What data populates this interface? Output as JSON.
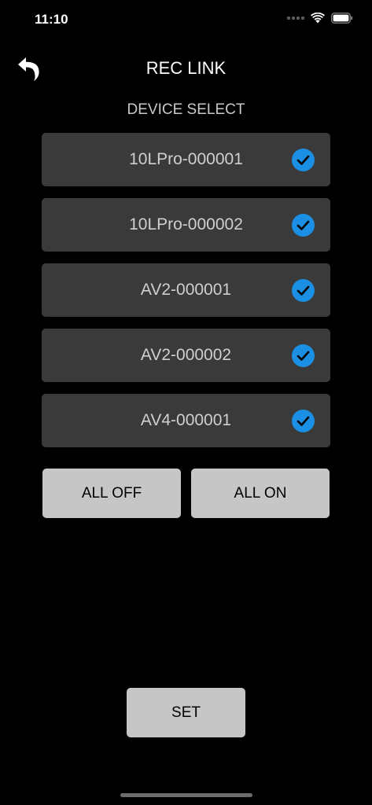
{
  "status_bar": {
    "time": "11:10"
  },
  "header": {
    "title": "REC LINK"
  },
  "section": {
    "title": "DEVICE SELECT"
  },
  "devices": [
    {
      "name": "10LPro-000001",
      "selected": true
    },
    {
      "name": "10LPro-000002",
      "selected": true
    },
    {
      "name": "AV2-000001",
      "selected": true
    },
    {
      "name": "AV2-000002",
      "selected": true
    },
    {
      "name": "AV4-000001",
      "selected": true
    }
  ],
  "buttons": {
    "all_off": "ALL OFF",
    "all_on": "ALL ON",
    "set": "SET"
  },
  "colors": {
    "background": "#000000",
    "row": "#3a3a3a",
    "button": "#c6c6c6",
    "check": "#1a8fe3"
  },
  "icons": {
    "back": "back-arrow-icon",
    "check": "checkmark-circle-icon",
    "wifi": "wifi-icon",
    "battery": "battery-icon"
  }
}
